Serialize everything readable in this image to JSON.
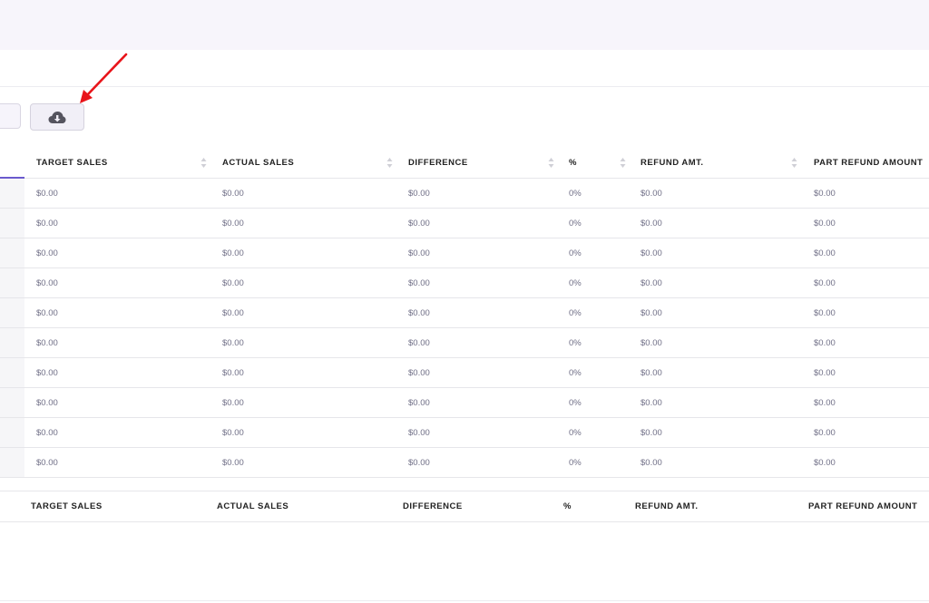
{
  "table": {
    "columns": [
      {
        "key": "target",
        "label": "TARGET SALES"
      },
      {
        "key": "actual",
        "label": "ACTUAL SALES"
      },
      {
        "key": "difference",
        "label": "DIFFERENCE"
      },
      {
        "key": "percent",
        "label": "%"
      },
      {
        "key": "refund",
        "label": "REFUND AMT."
      },
      {
        "key": "part_refund",
        "label": "PART REFUND AMOUNT"
      }
    ],
    "rows": [
      {
        "target": "$0.00",
        "actual": "$0.00",
        "difference": "$0.00",
        "percent": "0%",
        "refund": "$0.00",
        "part_refund": "$0.00"
      },
      {
        "target": "$0.00",
        "actual": "$0.00",
        "difference": "$0.00",
        "percent": "0%",
        "refund": "$0.00",
        "part_refund": "$0.00"
      },
      {
        "target": "$0.00",
        "actual": "$0.00",
        "difference": "$0.00",
        "percent": "0%",
        "refund": "$0.00",
        "part_refund": "$0.00"
      },
      {
        "target": "$0.00",
        "actual": "$0.00",
        "difference": "$0.00",
        "percent": "0%",
        "refund": "$0.00",
        "part_refund": "$0.00"
      },
      {
        "target": "$0.00",
        "actual": "$0.00",
        "difference": "$0.00",
        "percent": "0%",
        "refund": "$0.00",
        "part_refund": "$0.00"
      },
      {
        "target": "$0.00",
        "actual": "$0.00",
        "difference": "$0.00",
        "percent": "0%",
        "refund": "$0.00",
        "part_refund": "$0.00"
      },
      {
        "target": "$0.00",
        "actual": "$0.00",
        "difference": "$0.00",
        "percent": "0%",
        "refund": "$0.00",
        "part_refund": "$0.00"
      },
      {
        "target": "$0.00",
        "actual": "$0.00",
        "difference": "$0.00",
        "percent": "0%",
        "refund": "$0.00",
        "part_refund": "$0.00"
      },
      {
        "target": "$0.00",
        "actual": "$0.00",
        "difference": "$0.00",
        "percent": "0%",
        "refund": "$0.00",
        "part_refund": "$0.00"
      },
      {
        "target": "$0.00",
        "actual": "$0.00",
        "difference": "$0.00",
        "percent": "0%",
        "refund": "$0.00",
        "part_refund": "$0.00"
      }
    ],
    "footer": [
      "TARGET SALES",
      "ACTUAL SALES",
      "DIFFERENCE",
      "%",
      "REFUND AMT.",
      "PART REFUND AMOUNT"
    ]
  },
  "toolbar": {
    "download_icon": "cloud-download-icon"
  },
  "colors": {
    "accent": "#6a5acd",
    "annotation_arrow": "#e8141a",
    "cell_text": "#6f6e86",
    "header_text": "#222222"
  }
}
